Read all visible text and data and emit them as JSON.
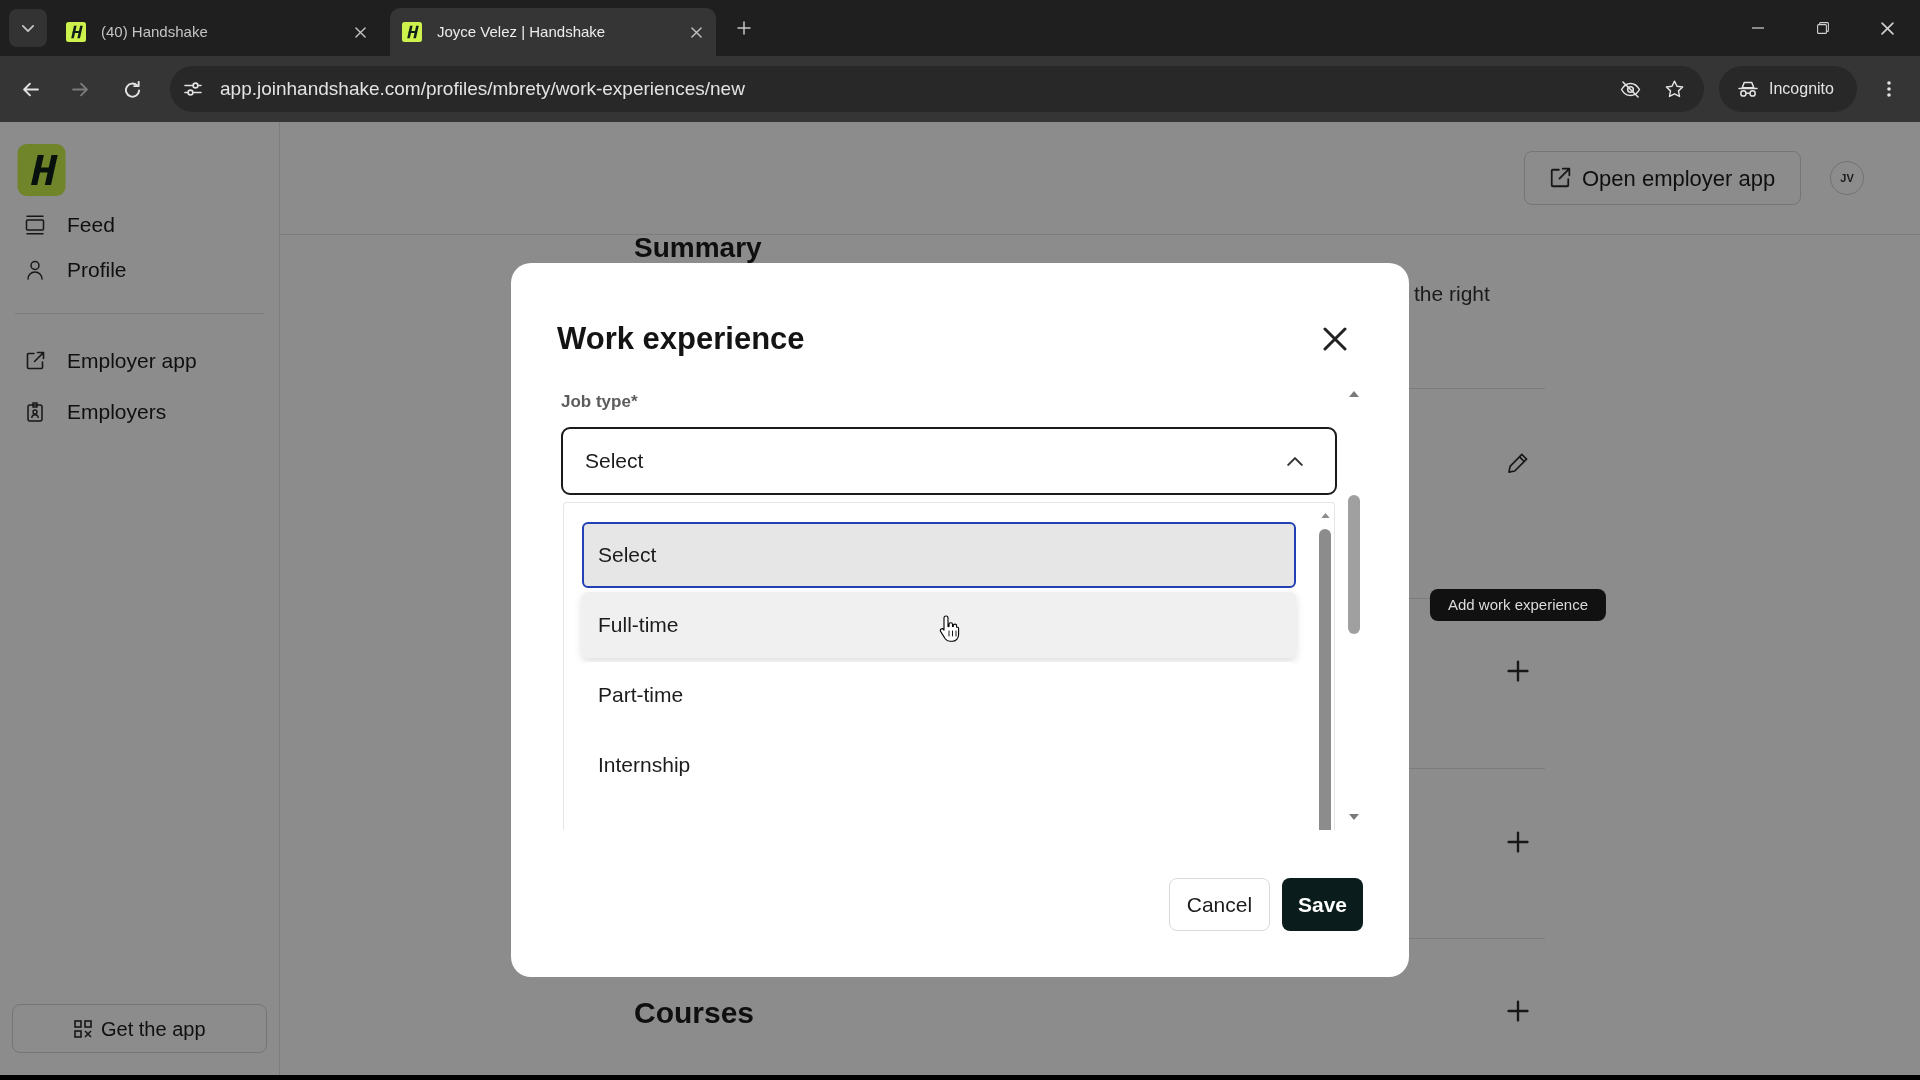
{
  "browser": {
    "tabs": [
      {
        "title": "(40) Handshake",
        "selected": false
      },
      {
        "title": "Joyce Velez | Handshake",
        "selected": true
      }
    ],
    "url": "app.joinhandshake.com/profiles/mbrety/work-experiences/new",
    "profile_label": "Incognito"
  },
  "sidebar": {
    "groups": [
      {
        "items": [
          {
            "label": "Feed"
          },
          {
            "label": "Profile"
          }
        ]
      },
      {
        "items": [
          {
            "label": "Employer app"
          },
          {
            "label": "Employers"
          }
        ]
      }
    ],
    "get_app_button": "Get the app"
  },
  "header": {
    "open_employer_button": "Open employer app",
    "avatar_initials": "JV"
  },
  "profile": {
    "sections": [
      {
        "kind": "summary",
        "heading": "Summary",
        "text": "the right"
      },
      {
        "kind": "edit"
      },
      {
        "kind": "add",
        "tooltip": "Add work experience"
      },
      {
        "kind": "add"
      },
      {
        "kind": "add",
        "heading": "Courses"
      }
    ]
  },
  "modal": {
    "title": "Work experience",
    "field_label": "Job type*",
    "select_value": "Select",
    "expanded": true,
    "options": [
      {
        "label": "Select",
        "selected": true,
        "hovered": false
      },
      {
        "label": "Full-time",
        "selected": false,
        "hovered": true
      },
      {
        "label": "Part-time",
        "selected": false,
        "hovered": false
      },
      {
        "label": "Internship",
        "selected": false,
        "hovered": false
      }
    ],
    "buttons": [
      {
        "label": "Cancel",
        "kind": "secondary"
      },
      {
        "label": "Save",
        "kind": "primary"
      }
    ]
  }
}
